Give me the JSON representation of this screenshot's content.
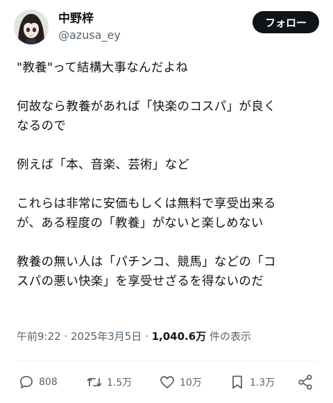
{
  "author": {
    "name": "中野梓",
    "handle": "@azusa_ey",
    "follow_label": "フォロー"
  },
  "paragraphs": [
    "\"教養\"って結構大事なんだよね",
    "何故なら教養があれば「快楽のコスパ」が良く\nなるので",
    "例えば「本、音楽、芸術」など",
    "これらは非常に安価もしくは無料で享受出来る\nが、ある程度の「教養」がないと楽しめない",
    "教養の無い人は「パチンコ、競馬」などの「コ\nスパの悪い快楽」を享受せざるを得ないのだ"
  ],
  "meta": {
    "time": "午前9:22",
    "date": "2025年3月5日",
    "views": "1,040.6万",
    "views_label": "件の表示"
  },
  "actions": {
    "reply_count": "808",
    "retweet_count": "1.5万",
    "like_count": "10万",
    "bookmark_count": "1.3万"
  },
  "icons": [
    "reply-icon",
    "retweet-icon",
    "like-icon",
    "bookmark-icon",
    "share-icon"
  ]
}
